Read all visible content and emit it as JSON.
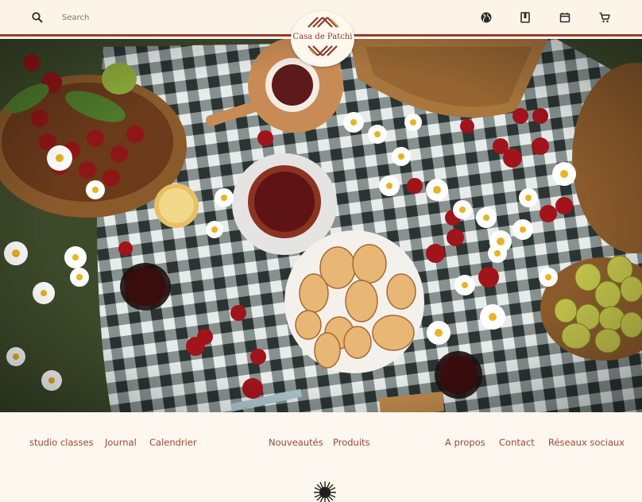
{
  "search": {
    "placeholder": "Search"
  },
  "header": {
    "icons": [
      "search-icon",
      "globe-icon",
      "book-icon",
      "calendar-icon",
      "cart-icon"
    ]
  },
  "logo": {
    "text": "Casa de Patchi"
  },
  "colors": {
    "brand": "#9a3b2a",
    "background": "#fdf7ef",
    "link": "#9b4a36"
  },
  "footer_nav": {
    "left": [
      "studio classes",
      "Journal",
      "Calendrier"
    ],
    "center": [
      "Nouveautés",
      "Produits"
    ],
    "right": [
      "A propos",
      "Contact",
      "Réseaux sociaux"
    ]
  },
  "hero": {
    "image": "picnic-table-photo"
  }
}
